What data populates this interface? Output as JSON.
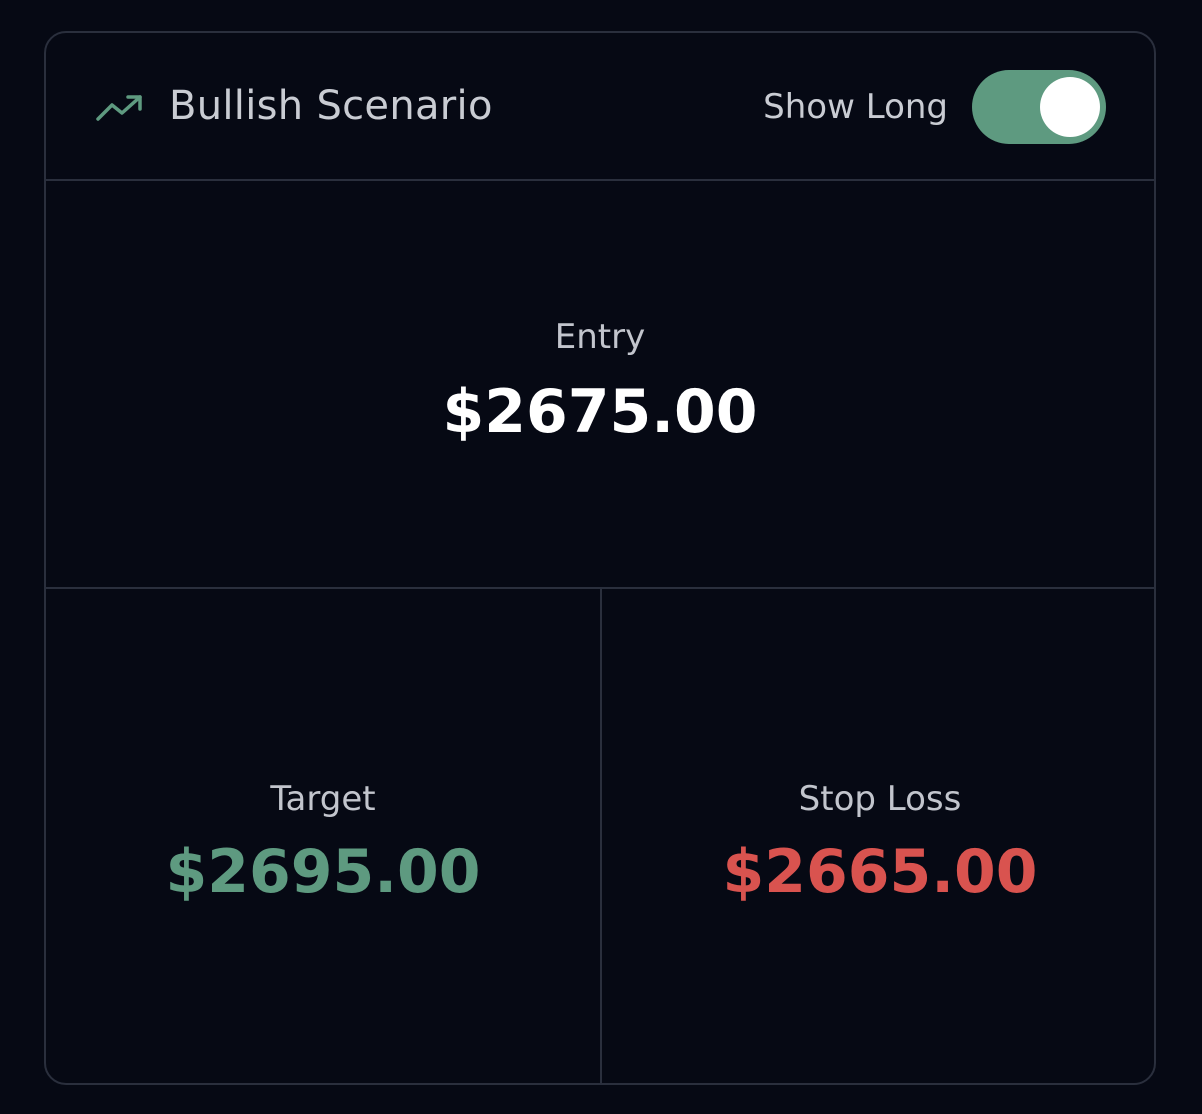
{
  "header": {
    "title": "Bullish Scenario",
    "icon": "trending-up-icon",
    "toggle_label": "Show Long",
    "toggle_on": true
  },
  "entry": {
    "label": "Entry",
    "value": "$2675.00"
  },
  "target": {
    "label": "Target",
    "value": "$2695.00"
  },
  "stop_loss": {
    "label": "Stop Loss",
    "value": "$2665.00"
  },
  "colors": {
    "background": "#060914",
    "border": "#2a2f3d",
    "accent_green": "#5e9a80",
    "accent_red": "#d9534f",
    "text_primary": "#ffffff",
    "text_secondary": "#c2c5cd"
  }
}
